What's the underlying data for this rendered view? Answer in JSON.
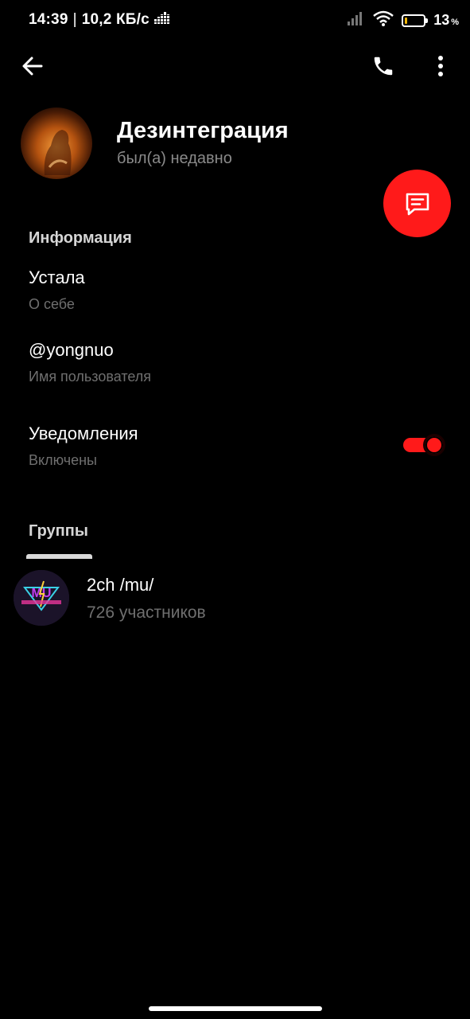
{
  "status_bar": {
    "time": "14:39",
    "separator": "|",
    "net_speed": "10,2 КБ/с",
    "battery_percent": "13",
    "battery_percent_sign": "%",
    "battery_level": 0.13,
    "battery_color": "#f2b705"
  },
  "toolbar": {
    "back_icon": "arrow-left-icon",
    "call_icon": "phone-icon",
    "more_icon": "more-vertical-icon"
  },
  "profile": {
    "name": "Дезинтеграция",
    "status": "был(а) недавно",
    "message_fab_icon": "message-icon",
    "accent_color": "#ff1a1a"
  },
  "info": {
    "section_title": "Информация",
    "bio_value": "Устала",
    "bio_label": "О себе",
    "username_value": "@yongnuo",
    "username_label": "Имя пользователя",
    "notifications_value": "Уведомления",
    "notifications_label": "Включены",
    "notifications_enabled": true
  },
  "groups": {
    "section_title": "Группы",
    "items": [
      {
        "name": "2ch /mu/",
        "members": "726 участников",
        "avatar_text": "MU"
      }
    ]
  }
}
